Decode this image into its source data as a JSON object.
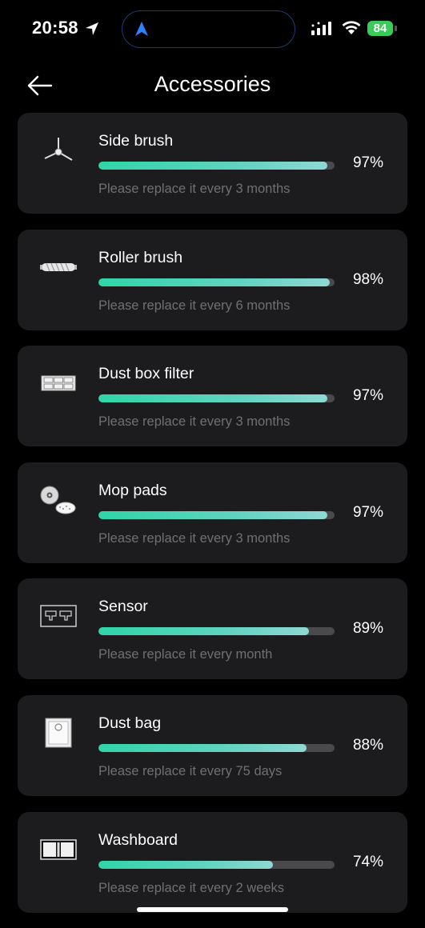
{
  "status_bar": {
    "time": "20:58",
    "battery": "84"
  },
  "header": {
    "title": "Accessories"
  },
  "accessories": [
    {
      "name": "Side brush",
      "percent_label": "97%",
      "percent": 97,
      "note": "Please replace it every 3 months",
      "icon": "side-brush-icon"
    },
    {
      "name": "Roller brush",
      "percent_label": "98%",
      "percent": 98,
      "note": "Please replace it every 6 months",
      "icon": "roller-brush-icon"
    },
    {
      "name": "Dust box filter",
      "percent_label": "97%",
      "percent": 97,
      "note": "Please replace it every 3 months",
      "icon": "dust-box-filter-icon"
    },
    {
      "name": "Mop pads",
      "percent_label": "97%",
      "percent": 97,
      "note": "Please replace it every 3 months",
      "icon": "mop-pads-icon"
    },
    {
      "name": "Sensor",
      "percent_label": "89%",
      "percent": 89,
      "note": "Please replace it every month",
      "icon": "sensor-icon"
    },
    {
      "name": "Dust bag",
      "percent_label": "88%",
      "percent": 88,
      "note": "Please replace it every 75 days",
      "icon": "dust-bag-icon"
    },
    {
      "name": "Washboard",
      "percent_label": "74%",
      "percent": 74,
      "note": "Please replace it every 2 weeks",
      "icon": "washboard-icon"
    }
  ],
  "colors": {
    "background": "#000000",
    "card": "#1c1c1e",
    "progress_start": "#2fd5a8",
    "progress_end": "#8fd8d3",
    "track": "#4a4a4c",
    "note_text": "#707074",
    "battery": "#3acb5b"
  }
}
